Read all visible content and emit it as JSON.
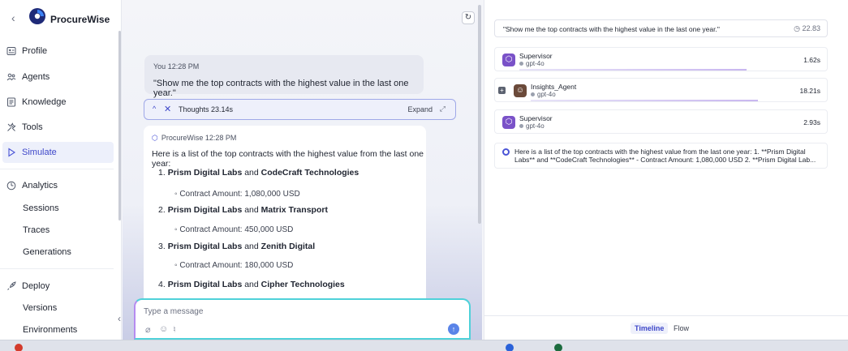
{
  "brand": {
    "name": "ProcureWise",
    "back_icon": "chevron-left-icon"
  },
  "sidebar": {
    "items": [
      {
        "id": "profile",
        "label": "Profile",
        "icon": "id-card-icon"
      },
      {
        "id": "agents",
        "label": "Agents",
        "icon": "agents-icon"
      },
      {
        "id": "knowledge",
        "label": "Knowledge",
        "icon": "book-icon"
      },
      {
        "id": "tools",
        "label": "Tools",
        "icon": "tools-icon"
      },
      {
        "id": "simulate",
        "label": "Simulate",
        "icon": "play-icon",
        "active": true
      }
    ],
    "analytics": {
      "label": "Analytics",
      "icon": "gauge-icon",
      "children": [
        "Sessions",
        "Traces",
        "Generations"
      ]
    },
    "deploy": {
      "label": "Deploy",
      "icon": "rocket-icon",
      "children": [
        "Versions",
        "Environments"
      ]
    }
  },
  "chat": {
    "user_message": {
      "sender": "You",
      "time": "12:28 PM",
      "text": "\"Show me the top contracts with the highest value in the last one year.\""
    },
    "thoughts": {
      "label": "Thoughts 23.14s",
      "expand_label": "Expand"
    },
    "bot_message": {
      "sender": "ProcureWise",
      "time": "12:28 PM",
      "intro": "Here is a list of the top contracts with the highest value from the last one year:",
      "items": [
        {
          "num": "1.",
          "a": "Prism Digital Labs",
          "b": "CodeCraft Technologies",
          "amount": "Contract Amount: 1,080,000 USD"
        },
        {
          "num": "2.",
          "a": "Prism Digital Labs",
          "b": "Matrix Transport",
          "amount": "Contract Amount: 450,000 USD"
        },
        {
          "num": "3.",
          "a": "Prism Digital Labs",
          "b": "Zenith Digital",
          "amount": "Contract Amount: 180,000 USD"
        },
        {
          "num": "4.",
          "a": "Prism Digital Labs",
          "b": "Cipher Technologies",
          "amount": ""
        }
      ],
      "conjunction": "and"
    },
    "composer": {
      "placeholder": "Type a message"
    }
  },
  "trace": {
    "query": "\"Show me the top contracts with the highest value in the last one year.\"",
    "total_time": "22.83",
    "steps": [
      {
        "name": "Supervisor",
        "model": "gpt-4o",
        "duration": "1.62s"
      },
      {
        "name": "Insights_Agent",
        "model": "gpt-4o",
        "duration": "18.21s"
      },
      {
        "name": "Supervisor",
        "model": "gpt-4o",
        "duration": "2.93s"
      }
    ],
    "result_text": "Here is a list of the top contracts with the highest value from the last one year: 1. **Prism Digital Labs** and **CodeCraft Technologies** - Contract Amount: 1,080,000 USD 2. **Prism Digital Lab...",
    "tabs": [
      "Timeline",
      "Flow"
    ],
    "active_tab": "Timeline"
  },
  "colors": {
    "accent": "#4a54d6",
    "active_bg": "#edf0fb",
    "composer_border": "#4fd1d9"
  }
}
